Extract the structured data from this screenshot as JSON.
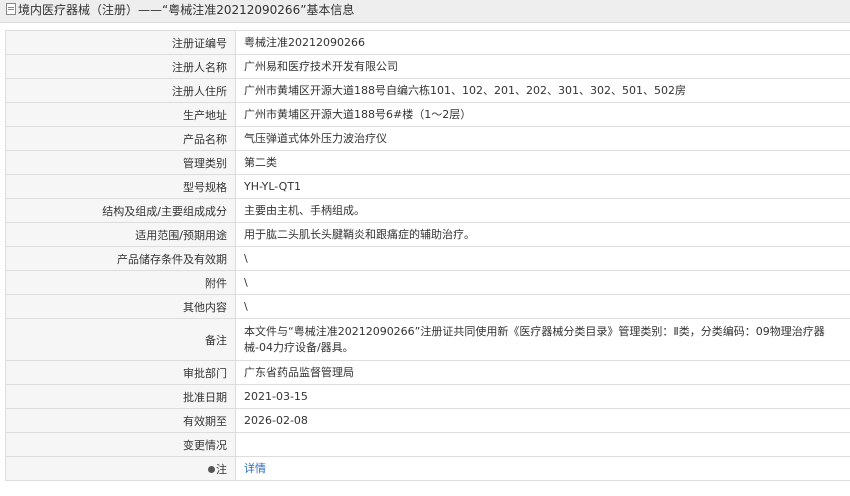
{
  "header": {
    "title": "境内医疗器械（注册）——“粤械注准20212090266”基本信息"
  },
  "rows": [
    {
      "label": "注册证编号",
      "value": "粤械注准20212090266"
    },
    {
      "label": "注册人名称",
      "value": "广州易和医疗技术开发有限公司"
    },
    {
      "label": "注册人住所",
      "value": "广州市黄埔区开源大道188号自编六栋101、102、201、202、301、302、501、502房"
    },
    {
      "label": "生产地址",
      "value": "广州市黄埔区开源大道188号6#楼（1～2层）"
    },
    {
      "label": "产品名称",
      "value": "气压弹道式体外压力波治疗仪"
    },
    {
      "label": "管理类别",
      "value": "第二类"
    },
    {
      "label": "型号规格",
      "value": "YH-YL-QT1"
    },
    {
      "label": "结构及组成/主要组成成分",
      "value": "主要由主机、手柄组成。"
    },
    {
      "label": "适用范围/预期用途",
      "value": "用于肱二头肌长头腱鞘炎和跟痛症的辅助治疗。"
    },
    {
      "label": "产品储存条件及有效期",
      "value": "\\"
    },
    {
      "label": "附件",
      "value": "\\"
    },
    {
      "label": "其他内容",
      "value": "\\"
    },
    {
      "label": "备注",
      "value": "本文件与“粤械注准20212090266”注册证共同使用新《医疗器械分类目录》管理类别：Ⅱ类，分类编码：09物理治疗器械-04力疗设备/器具。"
    },
    {
      "label": "审批部门",
      "value": "广东省药品监督管理局"
    },
    {
      "label": "批准日期",
      "value": "2021-03-15"
    },
    {
      "label": "有效期至",
      "value": "2026-02-08"
    },
    {
      "label": "变更情况",
      "value": ""
    }
  ],
  "note_row": {
    "label": "注",
    "link_text": "详情"
  },
  "colors": {
    "header_bg": "#eeeeee",
    "label_bg": "#f6f6f6",
    "border": "#dddddd",
    "link": "#2b6cc2"
  }
}
